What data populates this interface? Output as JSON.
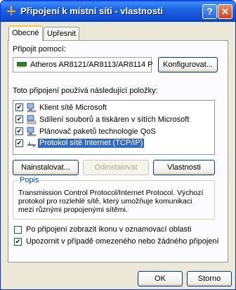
{
  "window": {
    "title": "Připojení k místní síti - vlastnosti",
    "help_glyph": "?",
    "close_glyph": "✕"
  },
  "tabs": [
    {
      "label": "Obecné",
      "active": true
    },
    {
      "label": "Upřesnit",
      "active": false
    }
  ],
  "connect_using": {
    "label": "Připojit pomocí:",
    "adapter": "Atheros AR8121/AR8113/AR8114 P",
    "configure_button": "Konfigurovat..."
  },
  "items_label": "Toto připojení používá následující položky:",
  "items": [
    {
      "label": "Klient sítě Microsoft",
      "checked": true,
      "icon": "network-client-icon"
    },
    {
      "label": "Sdílení souborů a tiskáren v sítích Microsoft",
      "checked": true,
      "icon": "file-printer-sharing-icon"
    },
    {
      "label": "Plánovač paketů technologie QoS",
      "checked": true,
      "icon": "qos-scheduler-icon"
    },
    {
      "label": "Protokol sítě Internet (TCP/IP)",
      "checked": true,
      "icon": "protocol-icon",
      "selected": true
    }
  ],
  "item_buttons": {
    "install": "Nainstalovat...",
    "uninstall": "Odinstalovat",
    "properties": "Vlastnosti"
  },
  "description": {
    "title": "Popis",
    "text": "Transmission Control Protocol/Internet Protocol. Výchozí protokol pro rozlehlé sítě, který umožňuje komunikaci mezi různými propojenými sítěmi."
  },
  "options": [
    {
      "label": "Po připojení zobrazit ikonu v oznamovací oblasti",
      "checked": false
    },
    {
      "label": "Upozornit v případě omezeného nebo žádného připojení",
      "checked": true
    }
  ],
  "check_glyph": "✔",
  "dialog_buttons": {
    "ok": "OK",
    "cancel": "Storno"
  },
  "colors": {
    "titlebar": "#0F4FD6",
    "selection": "#316AC5",
    "group_title": "#0046D5",
    "dialog_bg": "#ECE9D8"
  }
}
